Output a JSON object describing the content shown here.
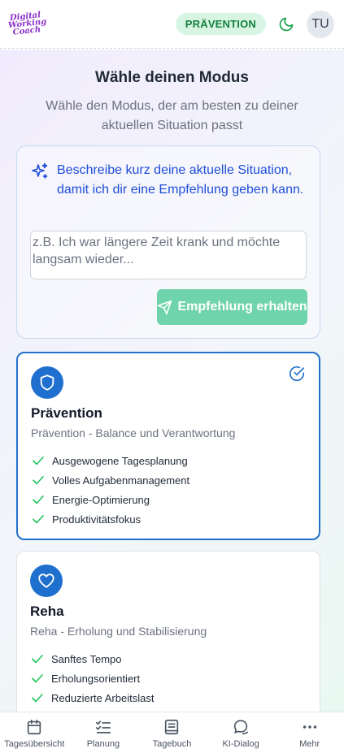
{
  "header": {
    "logo_lines": [
      "Digital",
      "Working",
      "Coach"
    ],
    "mode_badge": "PRÄVENTION",
    "avatar_initials": "TU"
  },
  "main": {
    "title": "Wähle deinen Modus",
    "subtitle": "Wähle den Modus, der am besten zu deiner aktuellen Situation passt",
    "recommendation": {
      "prompt": "Beschreibe kurz deine aktuelle Situation, damit ich dir eine Empfehlung geben kann.",
      "input_value": "",
      "input_placeholder": "z.B. Ich war längere Zeit krank und möchte langsam wieder...",
      "button_label": "Empfehlung erhalten"
    },
    "modes": [
      {
        "name": "Prävention",
        "description": "Prävention - Balance und Verantwortung",
        "icon": "shield-icon",
        "selected": true,
        "features": [
          "Ausgewogene Tagesplanung",
          "Volles Aufgabenmanagement",
          "Energie-Optimierung",
          "Produktivitätsfokus"
        ]
      },
      {
        "name": "Reha",
        "description": "Reha - Erholung und Stabilisierung",
        "icon": "heart-icon",
        "selected": false,
        "features": [
          "Sanftes Tempo",
          "Erholungsorientiert",
          "Reduzierte Arbeitslast"
        ]
      }
    ]
  },
  "bottom_nav": [
    {
      "label": "Tagesübersicht",
      "icon": "calendar-icon"
    },
    {
      "label": "Planung",
      "icon": "checklist-icon"
    },
    {
      "label": "Tagebuch",
      "icon": "journal-icon"
    },
    {
      "label": "KI-Dialog",
      "icon": "chat-icon"
    },
    {
      "label": "Mehr",
      "icon": "more-dots-icon"
    }
  ],
  "colors": {
    "primary_blue": "#1f6fcf",
    "accent_green": "#22c55e",
    "button_green": "#6fd3ab",
    "badge_bg": "#d8f5e3",
    "badge_text": "#15803d",
    "logo_purple": "#8b2fc9"
  }
}
